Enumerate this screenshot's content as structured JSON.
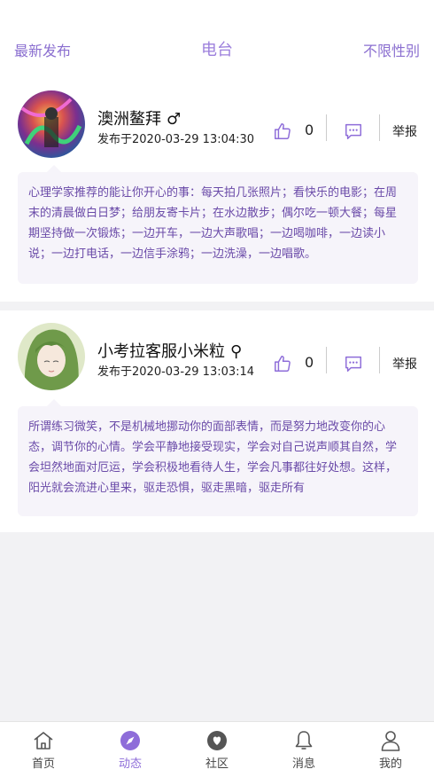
{
  "header": {
    "left": "最新发布",
    "title": "电台",
    "right": "不限性别"
  },
  "posts": [
    {
      "name": "澳洲鳌拜",
      "gender_symbol": "♂",
      "time": "发布于2020-03-29 13:04:30",
      "likes": "0",
      "report": "举报",
      "content": "心理学家推荐的能让你开心的事：每天拍几张照片；看快乐的电影；在周末的清晨做白日梦；给朋友寄卡片；在水边散步；偶尔吃一顿大餐；每星期坚持做一次锻炼；一边开车，一边大声歌唱；一边喝咖啡，一边读小说；一边打电话，一边信手涂鸦；一边洗澡，一边唱歌。"
    },
    {
      "name": "小考拉客服小米粒",
      "gender_symbol": "⚲",
      "time": "发布于2020-03-29 13:03:14",
      "likes": "0",
      "report": "举报",
      "content": "所谓练习微笑，不是机械地挪动你的面部表情，而是努力地改变你的心态，调节你的心情。学会平静地接受现实，学会对自己说声顺其自然，学会坦然地面对厄运，学会积极地看待人生，学会凡事都往好处想。这样，阳光就会流进心里来，驱走恐惧，驱走黑暗，驱走所有"
    }
  ],
  "tabs": [
    {
      "label": "首页"
    },
    {
      "label": "动态"
    },
    {
      "label": "社区"
    },
    {
      "label": "消息"
    },
    {
      "label": "我的"
    }
  ],
  "colors": {
    "accent": "#8e6dd9",
    "content_text": "#6a4aa8",
    "bubble_bg": "#f6f4fa"
  }
}
